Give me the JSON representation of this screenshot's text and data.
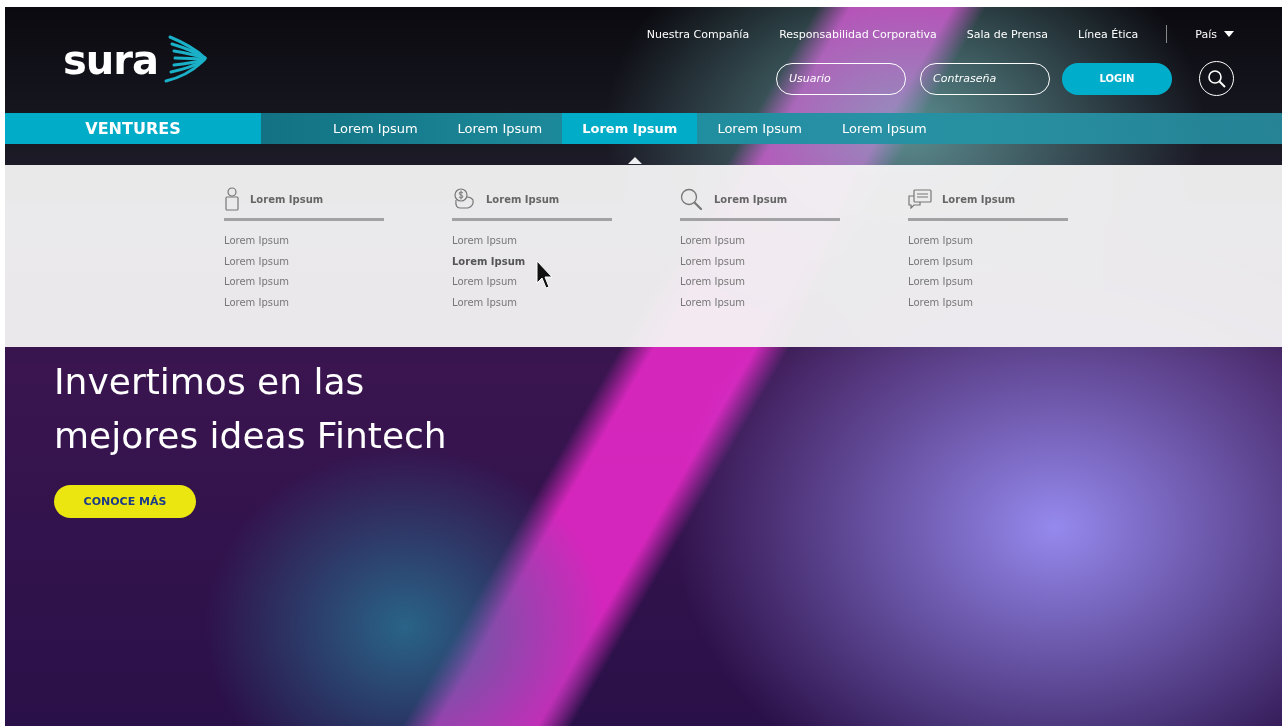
{
  "logo": {
    "text": "sura"
  },
  "top_links": [
    {
      "label": "Nuestra Compañía"
    },
    {
      "label": "Responsabilidad Corporativa"
    },
    {
      "label": "Sala de Prensa"
    },
    {
      "label": "Línea Ética"
    }
  ],
  "country_menu": {
    "label": "País"
  },
  "login": {
    "username_placeholder": "Usuario",
    "password_placeholder": "Contraseña",
    "button": "LOGIN"
  },
  "brand_tab": {
    "label": "VENTURES"
  },
  "nav_items": [
    {
      "label": "Lorem Ipsum",
      "selected": false
    },
    {
      "label": "Lorem Ipsum",
      "selected": false
    },
    {
      "label": "Lorem Ipsum",
      "selected": true
    },
    {
      "label": "Lorem Ipsum",
      "selected": false
    },
    {
      "label": "Lorem Ipsum",
      "selected": false
    }
  ],
  "mega_menu": {
    "columns": [
      {
        "kind": "person",
        "title": "Lorem Ipsum",
        "links": [
          {
            "label": "Lorem Ipsum",
            "selected": false
          },
          {
            "label": "Lorem Ipsum",
            "selected": false
          },
          {
            "label": "Lorem Ipsum",
            "selected": false
          },
          {
            "label": "Lorem Ipsum",
            "selected": false
          }
        ]
      },
      {
        "kind": "piggy-bank",
        "title": "Lorem Ipsum",
        "links": [
          {
            "label": "Lorem Ipsum",
            "selected": false
          },
          {
            "label": "Lorem Ipsum",
            "selected": true
          },
          {
            "label": "Lorem Ipsum",
            "selected": false
          },
          {
            "label": "Lorem Ipsum",
            "selected": false
          }
        ]
      },
      {
        "kind": "search",
        "title": "Lorem Ipsum",
        "links": [
          {
            "label": "Lorem Ipsum",
            "selected": false
          },
          {
            "label": "Lorem Ipsum",
            "selected": false
          },
          {
            "label": "Lorem Ipsum",
            "selected": false
          },
          {
            "label": "Lorem Ipsum",
            "selected": false
          }
        ]
      },
      {
        "kind": "chat",
        "title": "Lorem Ipsum",
        "links": [
          {
            "label": "Lorem Ipsum",
            "selected": false
          },
          {
            "label": "Lorem Ipsum",
            "selected": false
          },
          {
            "label": "Lorem Ipsum",
            "selected": false
          },
          {
            "label": "Lorem Ipsum",
            "selected": false
          }
        ]
      }
    ]
  },
  "hero": {
    "heading_lines": [
      "Invertimos en las",
      "mejores ideas Fintech"
    ],
    "button": "CONOCE MÁS"
  }
}
